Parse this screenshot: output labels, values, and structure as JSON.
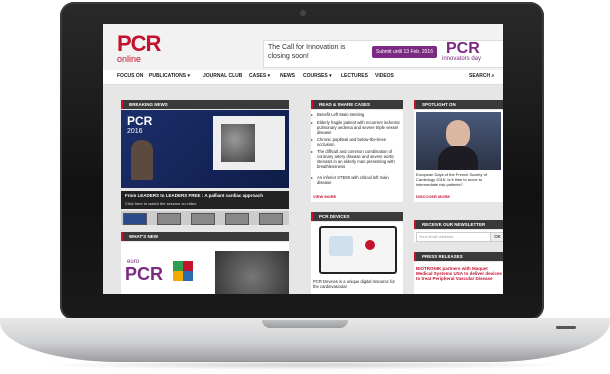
{
  "site": {
    "logo_main": "PCR",
    "logo_sub": "online",
    "banner_text": "The Call for Innovation is closing soon!",
    "banner_button": "Submit until 13 Feb. 2016",
    "banner_logo": "PCR",
    "banner_logo_sub": "innovators day"
  },
  "nav": {
    "items": [
      "FOCUS ON",
      "PUBLICATIONS ▾",
      "JOURNAL CLUB",
      "CASES ▾",
      "NEWS",
      "COURSES ▾",
      "LECTURES",
      "VIDEOS"
    ],
    "search": "SEARCH"
  },
  "breaking": {
    "title": "BREAKING NEWS",
    "video_logo": "PCR",
    "video_year": "2016",
    "caption": "From LEADERS to LEADERS FREE : A palliant cardiac approach",
    "sub": "Click here to watch the session on video"
  },
  "read_share": {
    "title": "READ & SHARE CASES",
    "items": [
      "Benefit Left Main stenting",
      "Elderly fragile patient with recurrent ischemic pulmonary oedema and severe triple vessel disease",
      "Chronic popliteal and below-the-knee occlusion",
      "The difficult and common combination of coronary artery disease and severe aortic stenosis in an elderly man presenting with breathlessness",
      "An inferior STEMI with critical left main disease"
    ],
    "more": "VIEW MORE"
  },
  "spotlight": {
    "title": "SPOTLIGHT ON",
    "text": "European Days of the French Society of Cardiology 2016: Is it time to move to intermediate risk patients?",
    "more": "DISCOVER MORE"
  },
  "pcr_devices": {
    "title": "PCR DEVICES",
    "text": "PCR Devices is a unique digital resource for the cardiovascular"
  },
  "newsletter": {
    "title": "RECEIVE OUR NEWSLETTER",
    "placeholder": "Your email address",
    "button": "OK"
  },
  "press": {
    "title": "PRESS RELEASES",
    "text": "BIOTRONIK partners with Maquet Medical Systems USA to deliver devices to treat Peripheral Vascular Disease"
  },
  "whats_new": {
    "title": "WHAT'S NEW",
    "logo_top": "euro",
    "logo_main": "PCR"
  }
}
